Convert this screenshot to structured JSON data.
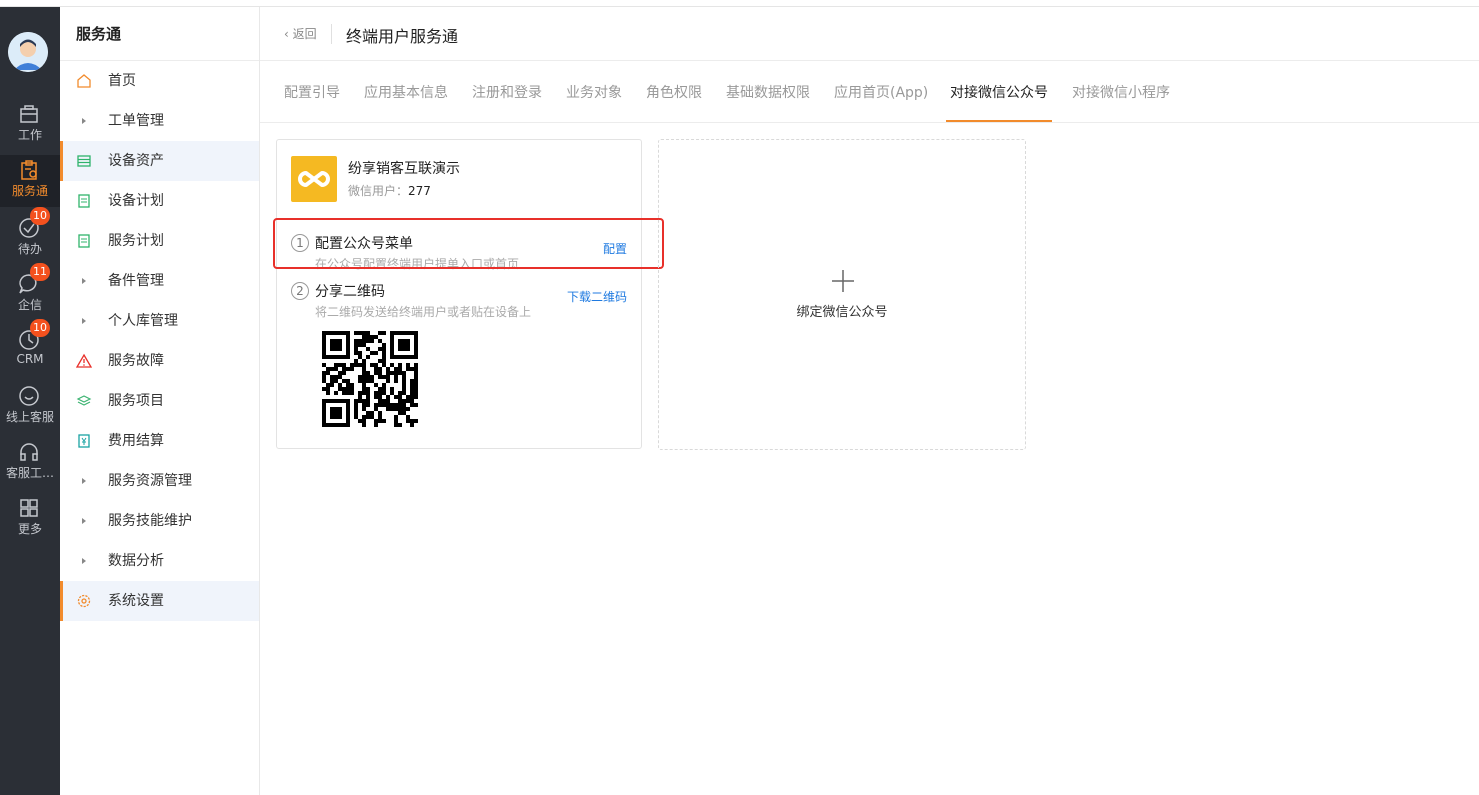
{
  "rail": {
    "items": [
      {
        "label": "工作",
        "icon": "briefcase-icon"
      },
      {
        "label": "服务通",
        "icon": "service-clipboard-icon"
      },
      {
        "label": "待办",
        "icon": "check-circle-icon",
        "badge": "10"
      },
      {
        "label": "企信",
        "icon": "chat-bubble-icon",
        "badge": "11"
      },
      {
        "label": "CRM",
        "icon": "clock-icon",
        "badge": "10"
      },
      {
        "label": "线上客服",
        "icon": "smile-chat-icon"
      },
      {
        "label": "客服工…",
        "icon": "headset-icon"
      },
      {
        "label": "更多",
        "icon": "grid-icon"
      }
    ]
  },
  "sidebar": {
    "title": "服务通",
    "items": [
      {
        "label": "首页",
        "icon": "home-icon"
      },
      {
        "label": "工单管理",
        "icon": "caret-right-icon"
      },
      {
        "label": "设备资产",
        "icon": "equipment-icon"
      },
      {
        "label": "设备计划",
        "icon": "document-icon"
      },
      {
        "label": "服务计划",
        "icon": "document-icon"
      },
      {
        "label": "备件管理",
        "icon": "caret-right-icon"
      },
      {
        "label": "个人库管理",
        "icon": "caret-right-icon"
      },
      {
        "label": "服务故障",
        "icon": "warning-icon"
      },
      {
        "label": "服务项目",
        "icon": "layers-icon"
      },
      {
        "label": "费用结算",
        "icon": "yuan-doc-icon"
      },
      {
        "label": "服务资源管理",
        "icon": "caret-right-icon"
      },
      {
        "label": "服务技能维护",
        "icon": "caret-right-icon"
      },
      {
        "label": "数据分析",
        "icon": "caret-right-icon"
      },
      {
        "label": "系统设置",
        "icon": "gear-icon"
      }
    ]
  },
  "header": {
    "back": "返回",
    "title": "终端用户服务通"
  },
  "tabs": [
    "配置引导",
    "应用基本信息",
    "注册和登录",
    "业务对象",
    "角色权限",
    "基础数据权限",
    "应用首页(App)",
    "对接微信公众号",
    "对接微信小程序"
  ],
  "account": {
    "name": "纷享销客互联演示",
    "users_label": "微信用户：",
    "users_count": "277",
    "step1": {
      "num": "1",
      "title": "配置公众号菜单",
      "desc": "在公众号配置终端用户提单入口或首页",
      "link": "配置"
    },
    "step2": {
      "num": "2",
      "title": "分享二维码",
      "desc": "将二维码发送给终端用户或者贴在设备上",
      "link": "下载二维码"
    }
  },
  "bind": {
    "label": "绑定微信公众号"
  },
  "colors": {
    "accent": "#f28b2c",
    "link": "#1f7ae0",
    "rail_bg": "#2b2f36",
    "highlight": "#e8302a",
    "logo": "#f5b922"
  }
}
